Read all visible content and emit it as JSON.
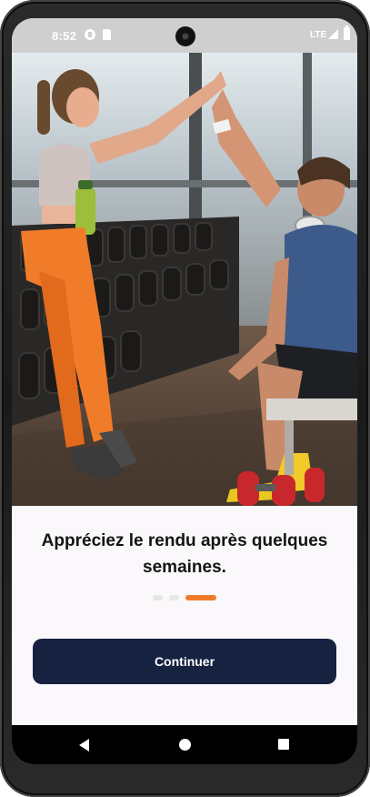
{
  "status_bar": {
    "time": "8:52",
    "network": "LTE",
    "icons": [
      "google-icon",
      "sd-card-icon",
      "signal-icon",
      "battery-icon"
    ]
  },
  "hero": {
    "image": "gym-couple-high-five-photo",
    "dominant_colors": {
      "outfit_orange": "#f07c2a",
      "shirt_blue": "#3c5a8a",
      "dumbbell_red": "#c8282b"
    }
  },
  "onboarding": {
    "headline": "Appréciez le rendu après quelques semaines.",
    "page_indicator": {
      "total": 3,
      "current": 3,
      "active_color": "#f07c2a"
    },
    "continue_label": "Continuer",
    "button_color": "#172240"
  },
  "nav_bar": {
    "icons": [
      "back-icon",
      "home-icon",
      "recents-icon"
    ]
  }
}
